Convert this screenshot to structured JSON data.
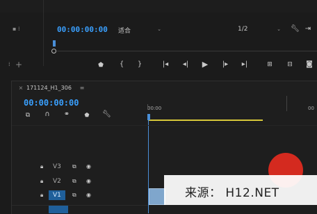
{
  "program_monitor": {
    "timecode": "00:00:00:00",
    "fit_label": "适合",
    "resolution_label": "1/2",
    "transport": {
      "marker_icon": "marker-icon",
      "in_icon": "mark-in-icon",
      "out_icon": "mark-out-icon",
      "go_in_icon": "go-to-in-icon",
      "step_back_icon": "step-back-icon",
      "play_icon": "play-icon",
      "step_forward_icon": "step-forward-icon",
      "go_out_icon": "go-to-out-icon",
      "lift_icon": "lift-icon",
      "extract_icon": "extract-icon",
      "export_frame_icon": "camera-icon"
    }
  },
  "timeline": {
    "sequence_name": "171124_H1_306",
    "timecode": "00:00:00:00",
    "ruler_start": "00:00",
    "tracks": [
      {
        "label": "V3"
      },
      {
        "label": "V2"
      },
      {
        "label": "V1",
        "selected": true
      }
    ]
  },
  "watermark": {
    "text": "来源： H12.NET"
  },
  "colors": {
    "accent_blue": "#3aa0ff",
    "playhead_blue": "#4a8fd8",
    "work_area_yellow": "#d8c93a",
    "clip_blue": "#7fa6cc",
    "red_button": "#d42a1f"
  }
}
